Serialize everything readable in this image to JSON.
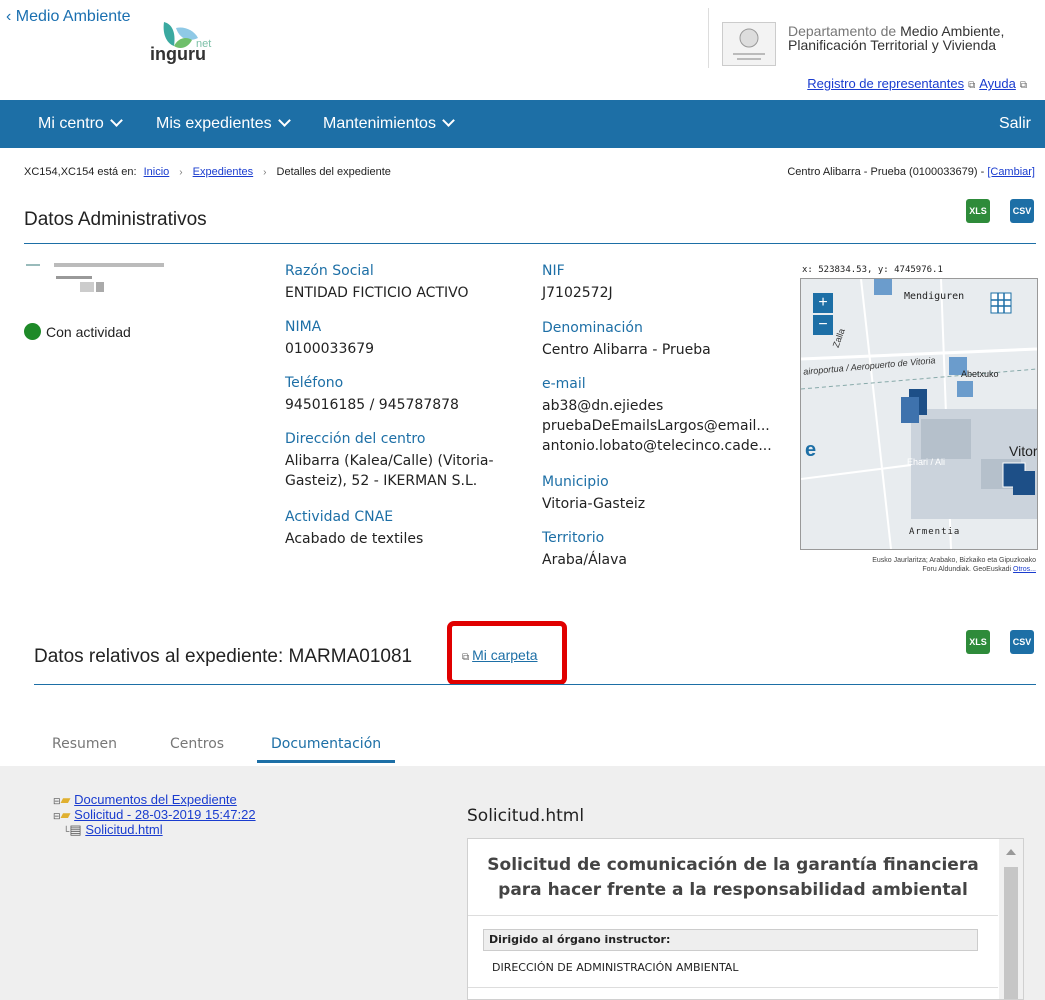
{
  "header": {
    "back_link": "Medio Ambiente",
    "logo_net": "net",
    "logo_word": "inguru",
    "dept_line1_light": "Departamento de ",
    "dept_line1_dark": "Medio Ambiente,",
    "dept_line2": "Planificación Territorial y Vivienda",
    "link_registro": "Registro de representantes",
    "link_ayuda": "Ayuda"
  },
  "nav": {
    "items": [
      "Mi centro",
      "Mis expedientes",
      "Mantenimientos"
    ],
    "logout": "Salir"
  },
  "breadcrumb": {
    "prefix": "XC154,XC154 está en:",
    "items": [
      "Inicio",
      "Expedientes",
      "Detalles del expediente"
    ],
    "center_text": "Centro Alibarra - Prueba (0100033679) - ",
    "change_link": "[Cambiar]"
  },
  "admin": {
    "title": "Datos Administrativos",
    "status": "Con actividad",
    "col1": [
      {
        "label": "Razón Social",
        "value": "ENTIDAD FICTICIO ACTIVO"
      },
      {
        "label": "NIMA",
        "value": "0100033679"
      },
      {
        "label": "Teléfono",
        "value": "945016185 / 945787878"
      },
      {
        "label": "Dirección del centro",
        "value": "Alibarra (Kalea/Calle) (Vitoria-Gasteiz), 52 - IKERMAN S.L."
      },
      {
        "label": "Actividad CNAE",
        "value": "Acabado de textiles"
      }
    ],
    "col2": [
      {
        "label": "NIF",
        "value": "J7102572J"
      },
      {
        "label": "Denominación",
        "value": "Centro Alibarra - Prueba"
      },
      {
        "label": "e-mail",
        "values": [
          "ab38@dn.ejiedes",
          "pruebaDeEmailsLargos@email...",
          "antonio.lobato@telecinco.cade..."
        ]
      },
      {
        "label": "Municipio",
        "value": "Vitoria-Gasteiz"
      },
      {
        "label": "Territorio",
        "value": "Araba/Álava"
      }
    ]
  },
  "map": {
    "coords": "x: 523834.53, y: 4745976.1",
    "zoom_in": "+",
    "zoom_out": "−",
    "place_labels": [
      "Mendiguren",
      "Zalla",
      "airoportua / Aeropuerto de Vitoria",
      "Abetxuko",
      "Ehari / Ali",
      "Vitor",
      "Armentia"
    ],
    "credit_line1": "Eusko Jaurlaritza; Arabako, Bizkaiko eta Gipuzkoako",
    "credit_line2": "Foru Aldundiak. GeoEuskadi",
    "credit_link": "Otros..."
  },
  "expediente": {
    "title": "Datos relativos al expediente: MARMA01081",
    "folder_link": "Mi carpeta"
  },
  "tabs": [
    "Resumen",
    "Centros",
    "Documentación"
  ],
  "tree": {
    "root": "Documentos del Expediente",
    "child": "Solicitud - 28-03-2019 15:47:22",
    "leaf": "Solicitud.html"
  },
  "doc": {
    "title": "Solicitud.html",
    "heading_line1": "Solicitud de comunicación de la garantía financiera",
    "heading_line2": "para hacer frente a la responsabilidad ambiental",
    "field_label": "Dirigido al órgano instructor:",
    "field_value": "DIRECCIÓN DE ADMINISTRACIÓN AMBIENTAL"
  },
  "file_buttons": {
    "xls": "XLS",
    "csv": "CSV"
  },
  "colors": {
    "navbar": "#1d6fa6",
    "status_active": "#1e8a28",
    "highlight": "#e00000"
  }
}
